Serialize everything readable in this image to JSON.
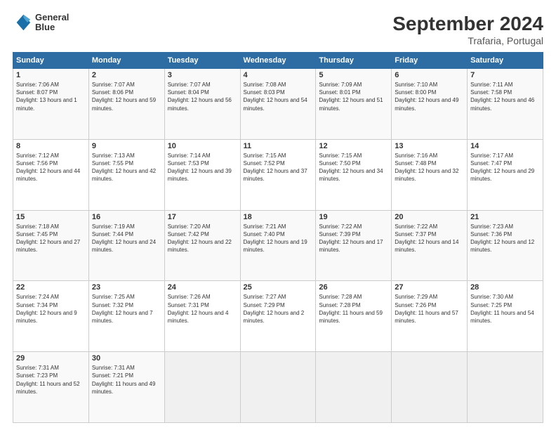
{
  "header": {
    "logo_line1": "General",
    "logo_line2": "Blue",
    "title": "September 2024",
    "subtitle": "Trafaria, Portugal"
  },
  "days_of_week": [
    "Sunday",
    "Monday",
    "Tuesday",
    "Wednesday",
    "Thursday",
    "Friday",
    "Saturday"
  ],
  "weeks": [
    [
      {
        "day": "1",
        "sunrise": "7:06 AM",
        "sunset": "8:07 PM",
        "daylight": "13 hours and 1 minute."
      },
      {
        "day": "2",
        "sunrise": "7:07 AM",
        "sunset": "8:06 PM",
        "daylight": "12 hours and 59 minutes."
      },
      {
        "day": "3",
        "sunrise": "7:07 AM",
        "sunset": "8:04 PM",
        "daylight": "12 hours and 56 minutes."
      },
      {
        "day": "4",
        "sunrise": "7:08 AM",
        "sunset": "8:03 PM",
        "daylight": "12 hours and 54 minutes."
      },
      {
        "day": "5",
        "sunrise": "7:09 AM",
        "sunset": "8:01 PM",
        "daylight": "12 hours and 51 minutes."
      },
      {
        "day": "6",
        "sunrise": "7:10 AM",
        "sunset": "8:00 PM",
        "daylight": "12 hours and 49 minutes."
      },
      {
        "day": "7",
        "sunrise": "7:11 AM",
        "sunset": "7:58 PM",
        "daylight": "12 hours and 46 minutes."
      }
    ],
    [
      {
        "day": "8",
        "sunrise": "7:12 AM",
        "sunset": "7:56 PM",
        "daylight": "12 hours and 44 minutes."
      },
      {
        "day": "9",
        "sunrise": "7:13 AM",
        "sunset": "7:55 PM",
        "daylight": "12 hours and 42 minutes."
      },
      {
        "day": "10",
        "sunrise": "7:14 AM",
        "sunset": "7:53 PM",
        "daylight": "12 hours and 39 minutes."
      },
      {
        "day": "11",
        "sunrise": "7:15 AM",
        "sunset": "7:52 PM",
        "daylight": "12 hours and 37 minutes."
      },
      {
        "day": "12",
        "sunrise": "7:15 AM",
        "sunset": "7:50 PM",
        "daylight": "12 hours and 34 minutes."
      },
      {
        "day": "13",
        "sunrise": "7:16 AM",
        "sunset": "7:48 PM",
        "daylight": "12 hours and 32 minutes."
      },
      {
        "day": "14",
        "sunrise": "7:17 AM",
        "sunset": "7:47 PM",
        "daylight": "12 hours and 29 minutes."
      }
    ],
    [
      {
        "day": "15",
        "sunrise": "7:18 AM",
        "sunset": "7:45 PM",
        "daylight": "12 hours and 27 minutes."
      },
      {
        "day": "16",
        "sunrise": "7:19 AM",
        "sunset": "7:44 PM",
        "daylight": "12 hours and 24 minutes."
      },
      {
        "day": "17",
        "sunrise": "7:20 AM",
        "sunset": "7:42 PM",
        "daylight": "12 hours and 22 minutes."
      },
      {
        "day": "18",
        "sunrise": "7:21 AM",
        "sunset": "7:40 PM",
        "daylight": "12 hours and 19 minutes."
      },
      {
        "day": "19",
        "sunrise": "7:22 AM",
        "sunset": "7:39 PM",
        "daylight": "12 hours and 17 minutes."
      },
      {
        "day": "20",
        "sunrise": "7:22 AM",
        "sunset": "7:37 PM",
        "daylight": "12 hours and 14 minutes."
      },
      {
        "day": "21",
        "sunrise": "7:23 AM",
        "sunset": "7:36 PM",
        "daylight": "12 hours and 12 minutes."
      }
    ],
    [
      {
        "day": "22",
        "sunrise": "7:24 AM",
        "sunset": "7:34 PM",
        "daylight": "12 hours and 9 minutes."
      },
      {
        "day": "23",
        "sunrise": "7:25 AM",
        "sunset": "7:32 PM",
        "daylight": "12 hours and 7 minutes."
      },
      {
        "day": "24",
        "sunrise": "7:26 AM",
        "sunset": "7:31 PM",
        "daylight": "12 hours and 4 minutes."
      },
      {
        "day": "25",
        "sunrise": "7:27 AM",
        "sunset": "7:29 PM",
        "daylight": "12 hours and 2 minutes."
      },
      {
        "day": "26",
        "sunrise": "7:28 AM",
        "sunset": "7:28 PM",
        "daylight": "11 hours and 59 minutes."
      },
      {
        "day": "27",
        "sunrise": "7:29 AM",
        "sunset": "7:26 PM",
        "daylight": "11 hours and 57 minutes."
      },
      {
        "day": "28",
        "sunrise": "7:30 AM",
        "sunset": "7:25 PM",
        "daylight": "11 hours and 54 minutes."
      }
    ],
    [
      {
        "day": "29",
        "sunrise": "7:31 AM",
        "sunset": "7:23 PM",
        "daylight": "11 hours and 52 minutes."
      },
      {
        "day": "30",
        "sunrise": "7:31 AM",
        "sunset": "7:21 PM",
        "daylight": "11 hours and 49 minutes."
      },
      null,
      null,
      null,
      null,
      null
    ]
  ]
}
